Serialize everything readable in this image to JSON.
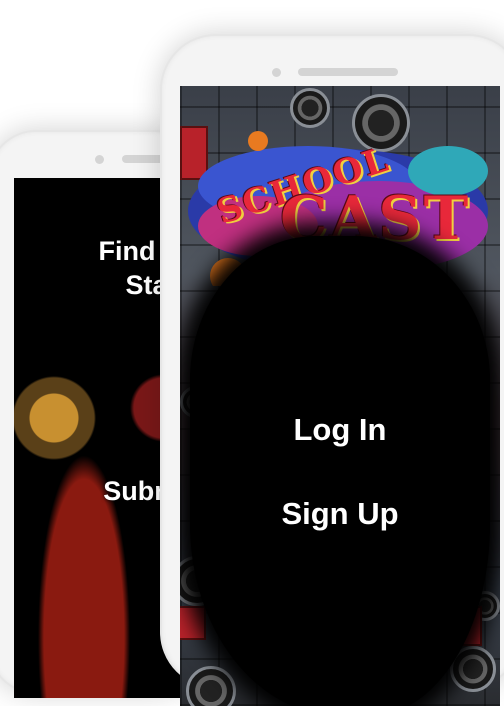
{
  "back_screen": {
    "find_line1": "Find a S",
    "find_line2": "Stat",
    "submit": "Submit"
  },
  "front_screen": {
    "logo_line1": "SCHOOL",
    "logo_line2": "CAST",
    "login": "Log In",
    "signup": "Sign Up"
  },
  "colors": {
    "logo_red": "#e8283a",
    "button_text": "#ffffff",
    "phone_frame": "#f4f4f4"
  }
}
